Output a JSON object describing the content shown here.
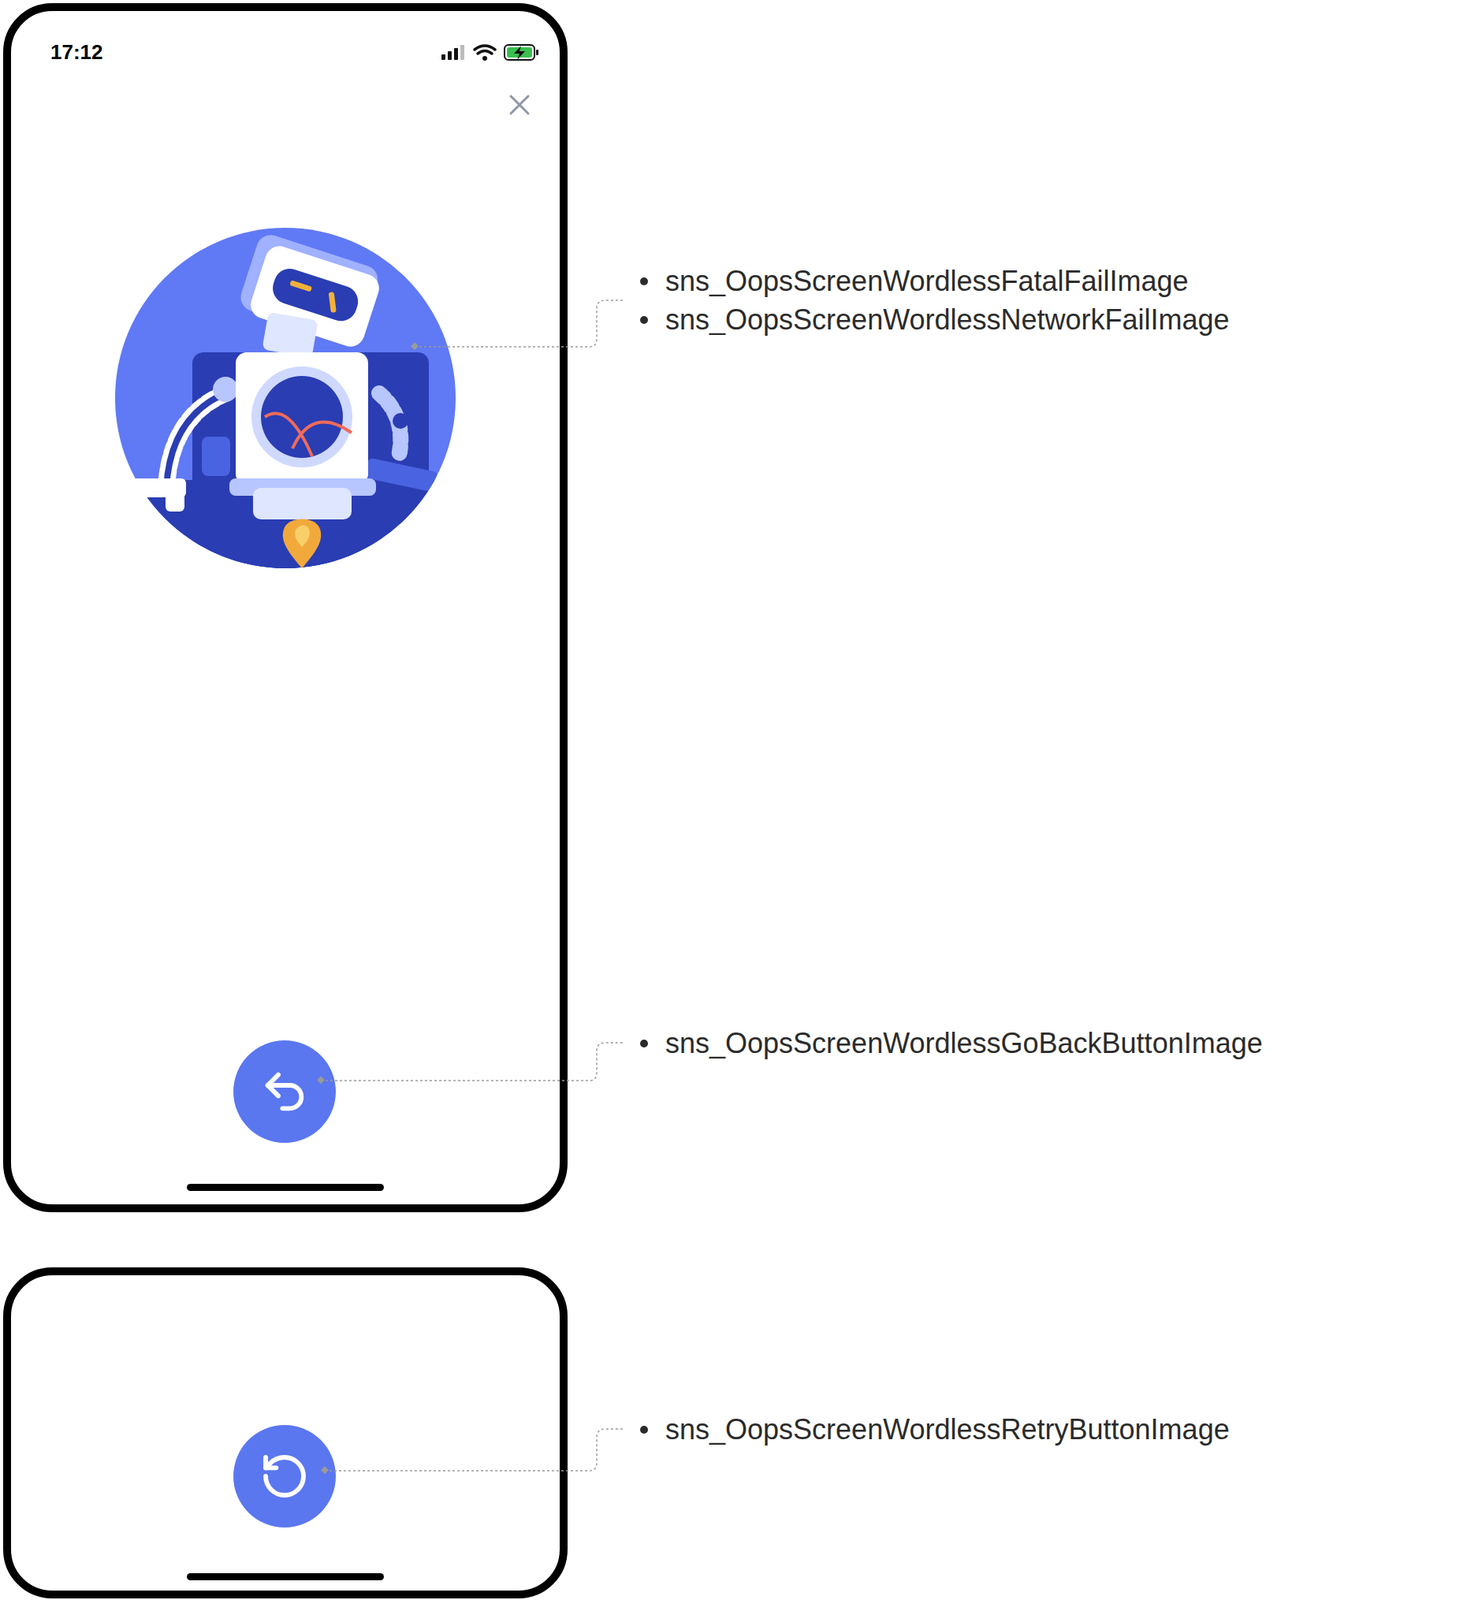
{
  "status_bar": {
    "time": "17:12"
  },
  "callouts": [
    {
      "target": "fail-image",
      "labels": [
        "sns_OopsScreenWordlessFatalFailImage",
        "sns_OopsScreenWordlessNetworkFailImage"
      ]
    },
    {
      "target": "go-back-button",
      "labels": [
        "sns_OopsScreenWordlessGoBackButtonImage"
      ]
    },
    {
      "target": "retry-button",
      "labels": [
        "sns_OopsScreenWordlessRetryButtonImage"
      ]
    }
  ]
}
